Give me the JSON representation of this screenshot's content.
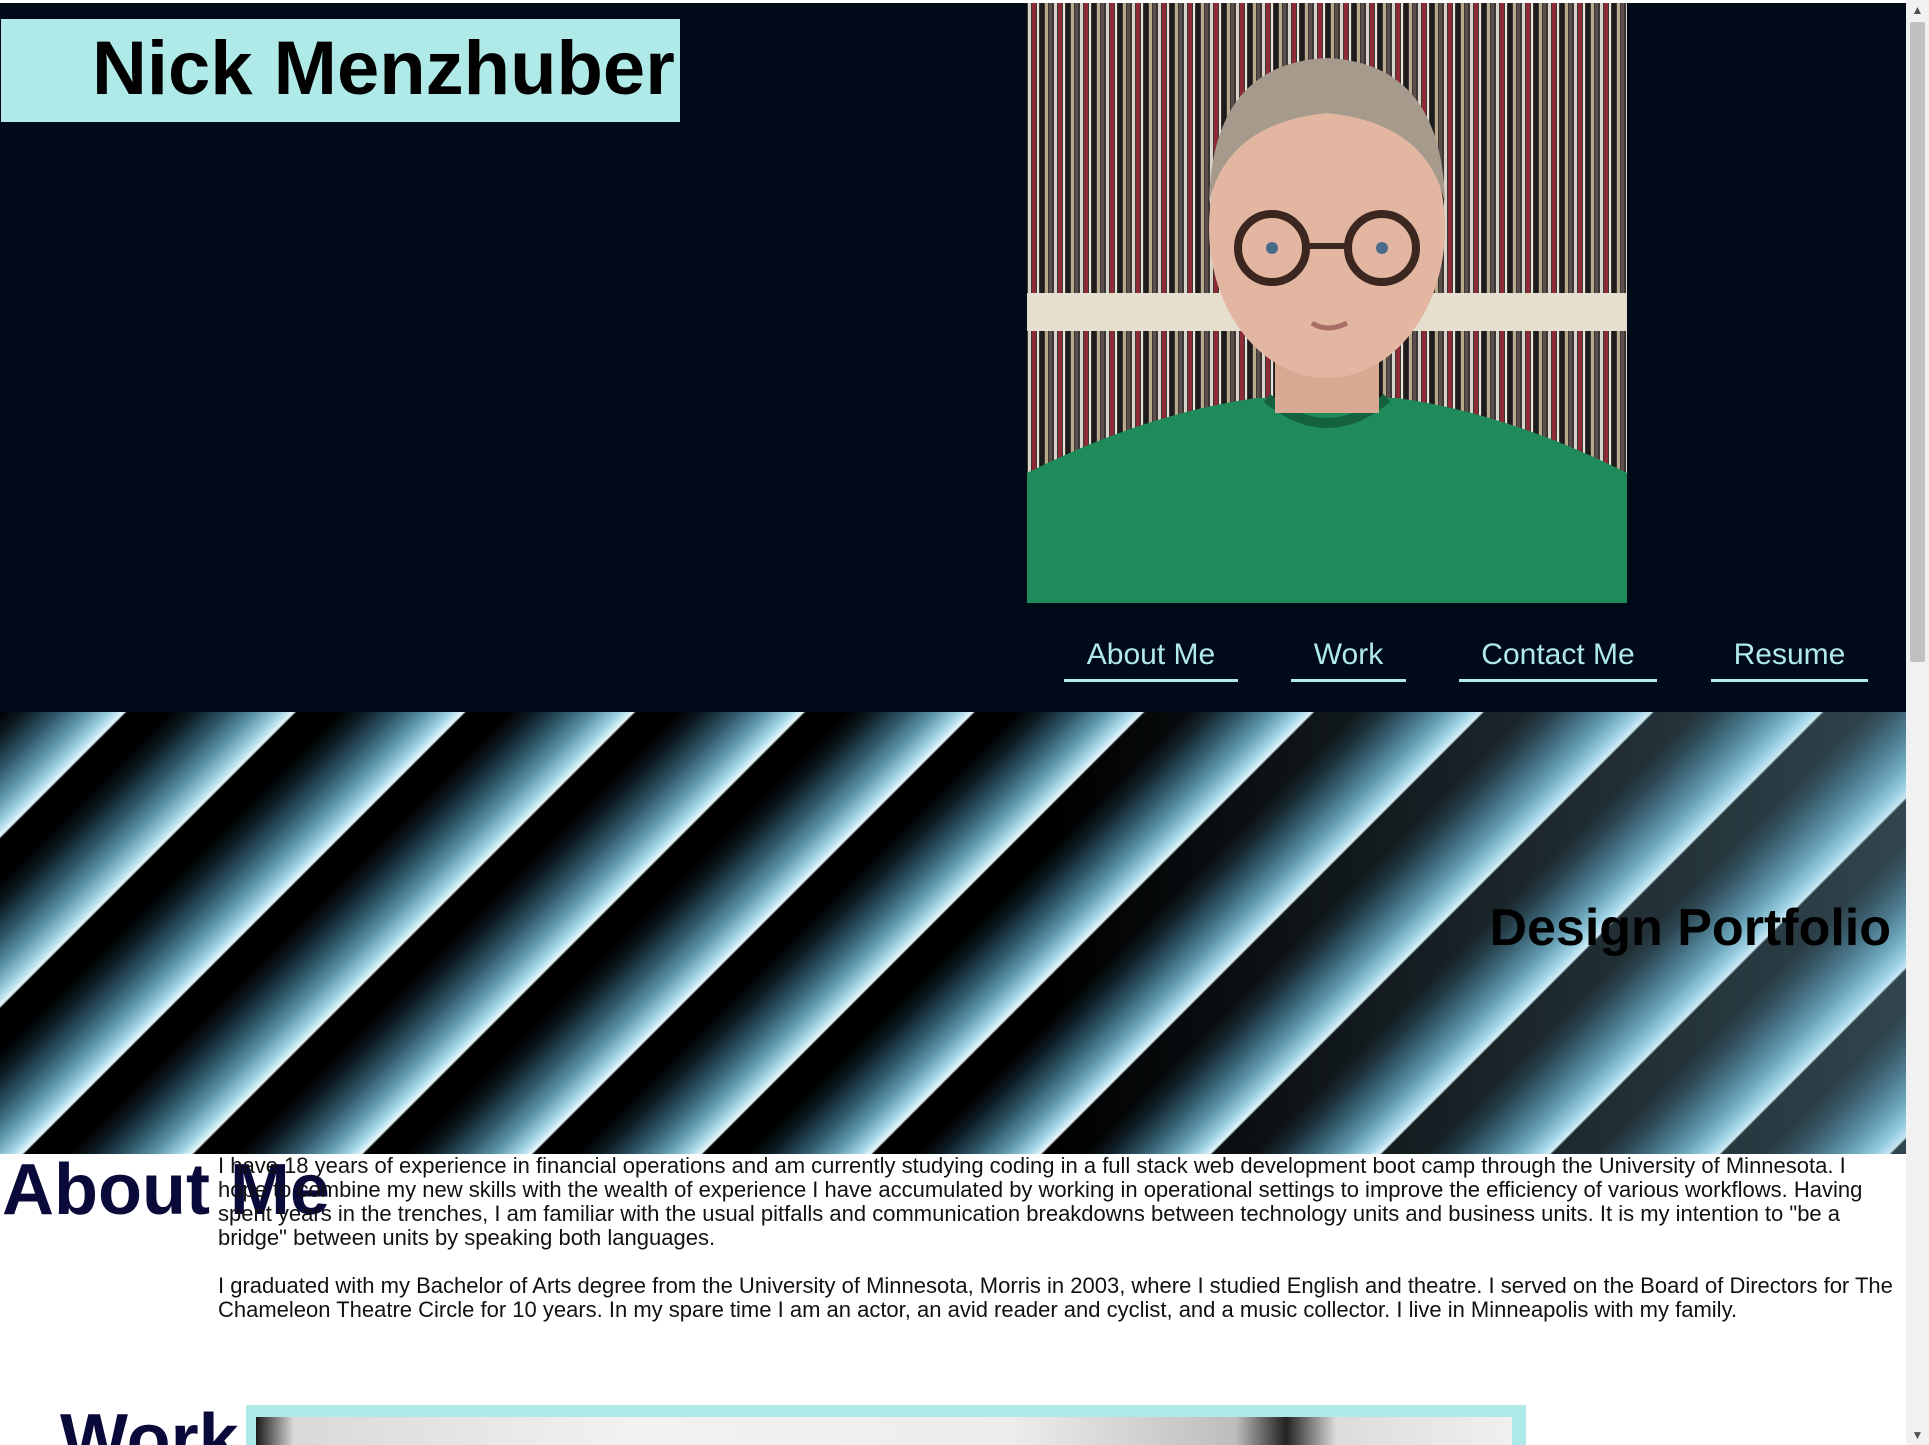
{
  "header": {
    "name": "Nick Menzhuber",
    "nav": [
      {
        "label": "About Me"
      },
      {
        "label": "Work"
      },
      {
        "label": "Contact Me"
      },
      {
        "label": "Resume"
      }
    ]
  },
  "banner": {
    "title": "Design Portfolio"
  },
  "about": {
    "heading": "About Me",
    "paragraphs": [
      "I have 18 years of experience in financial operations and am currently studying coding in a full stack web development boot camp through the University of Minnesota. I hope to combine my new skills with the wealth of experience I have accumulated by working in operational settings to improve the efficiency of various workflows. Having spent years in the trenches, I am familiar with the usual pitfalls and communication breakdowns between technology units and business units. It is my intention to \"be a bridge\" between units by speaking both languages.",
      "I graduated with my Bachelor of Arts degree from the University of Minnesota, Morris in 2003, where I studied English and theatre. I served on the Board of Directors for The Chameleon Theatre Circle for 10 years. In my spare time I am an actor, an avid reader and cyclist, and a music collector. I live in Minneapolis with my family."
    ]
  },
  "work": {
    "heading": "Work"
  },
  "colors": {
    "header_bg": "#010a18",
    "accent": "#afe9e8",
    "heading_text": "#0a0a3a"
  },
  "icons": {
    "scroll_up": "▲",
    "scroll_down": "▼"
  }
}
